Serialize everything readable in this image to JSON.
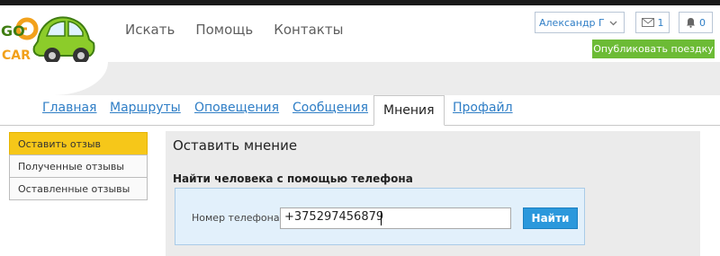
{
  "logo": {
    "text_go": "GO",
    "text_car": "CAR"
  },
  "nav": {
    "items": [
      "Искать",
      "Помощь",
      "Контакты"
    ]
  },
  "header": {
    "user_name": "Александр Г",
    "messages_count": "1",
    "notifications_count": "0",
    "publish_label": "Опубликовать поездку"
  },
  "tabs": [
    {
      "label": "Главная",
      "active": false
    },
    {
      "label": "Маршруты",
      "active": false
    },
    {
      "label": "Оповещения",
      "active": false
    },
    {
      "label": "Сообщения",
      "active": false
    },
    {
      "label": "Мнения",
      "active": true
    },
    {
      "label": "Профайл",
      "active": false
    }
  ],
  "sidebar": {
    "items": [
      {
        "label": "Оставить отзыв",
        "active": true
      },
      {
        "label": "Полученные отзывы",
        "active": false
      },
      {
        "label": "Оставленные отзывы",
        "active": false
      }
    ]
  },
  "main": {
    "title": "Оставить мнение",
    "subtitle": "Найти человека с помощью телефона",
    "phone_label": "Номер телефона",
    "phone_value": "+375297456879",
    "find_button": "Найти"
  },
  "colors": {
    "accent_green": "#6cbb35",
    "link_blue": "#2f7ec6",
    "sidebar_active": "#f6c719",
    "button_blue": "#2b98dc"
  }
}
